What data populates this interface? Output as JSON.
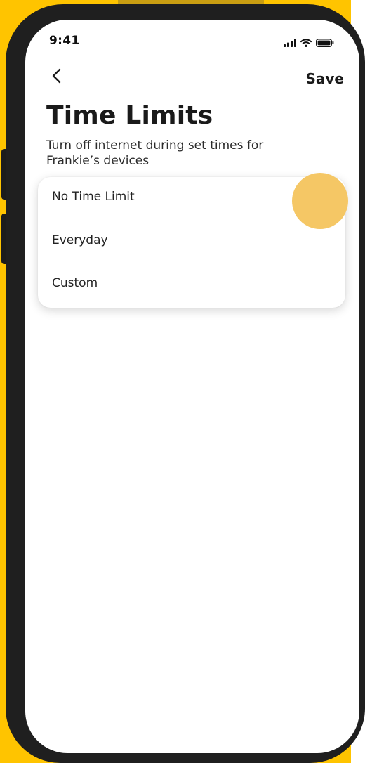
{
  "status_bar": {
    "time": "9:41",
    "icons": [
      "signal-icon",
      "wifi-icon",
      "battery-icon"
    ]
  },
  "nav": {
    "back_icon": "chevron-left-icon",
    "save_label": "Save"
  },
  "page": {
    "title": "Time Limits",
    "subtitle": "Turn off internet during set times for Frankie’s devices"
  },
  "options": [
    {
      "label": "No Time Limit"
    },
    {
      "label": "Everyday"
    },
    {
      "label": "Custom"
    }
  ],
  "colors": {
    "background_accent": "#FFC400",
    "touch_indicator": "#F5C765",
    "phone_frame": "#1F1F1F",
    "text_primary": "#1A1A1A"
  }
}
